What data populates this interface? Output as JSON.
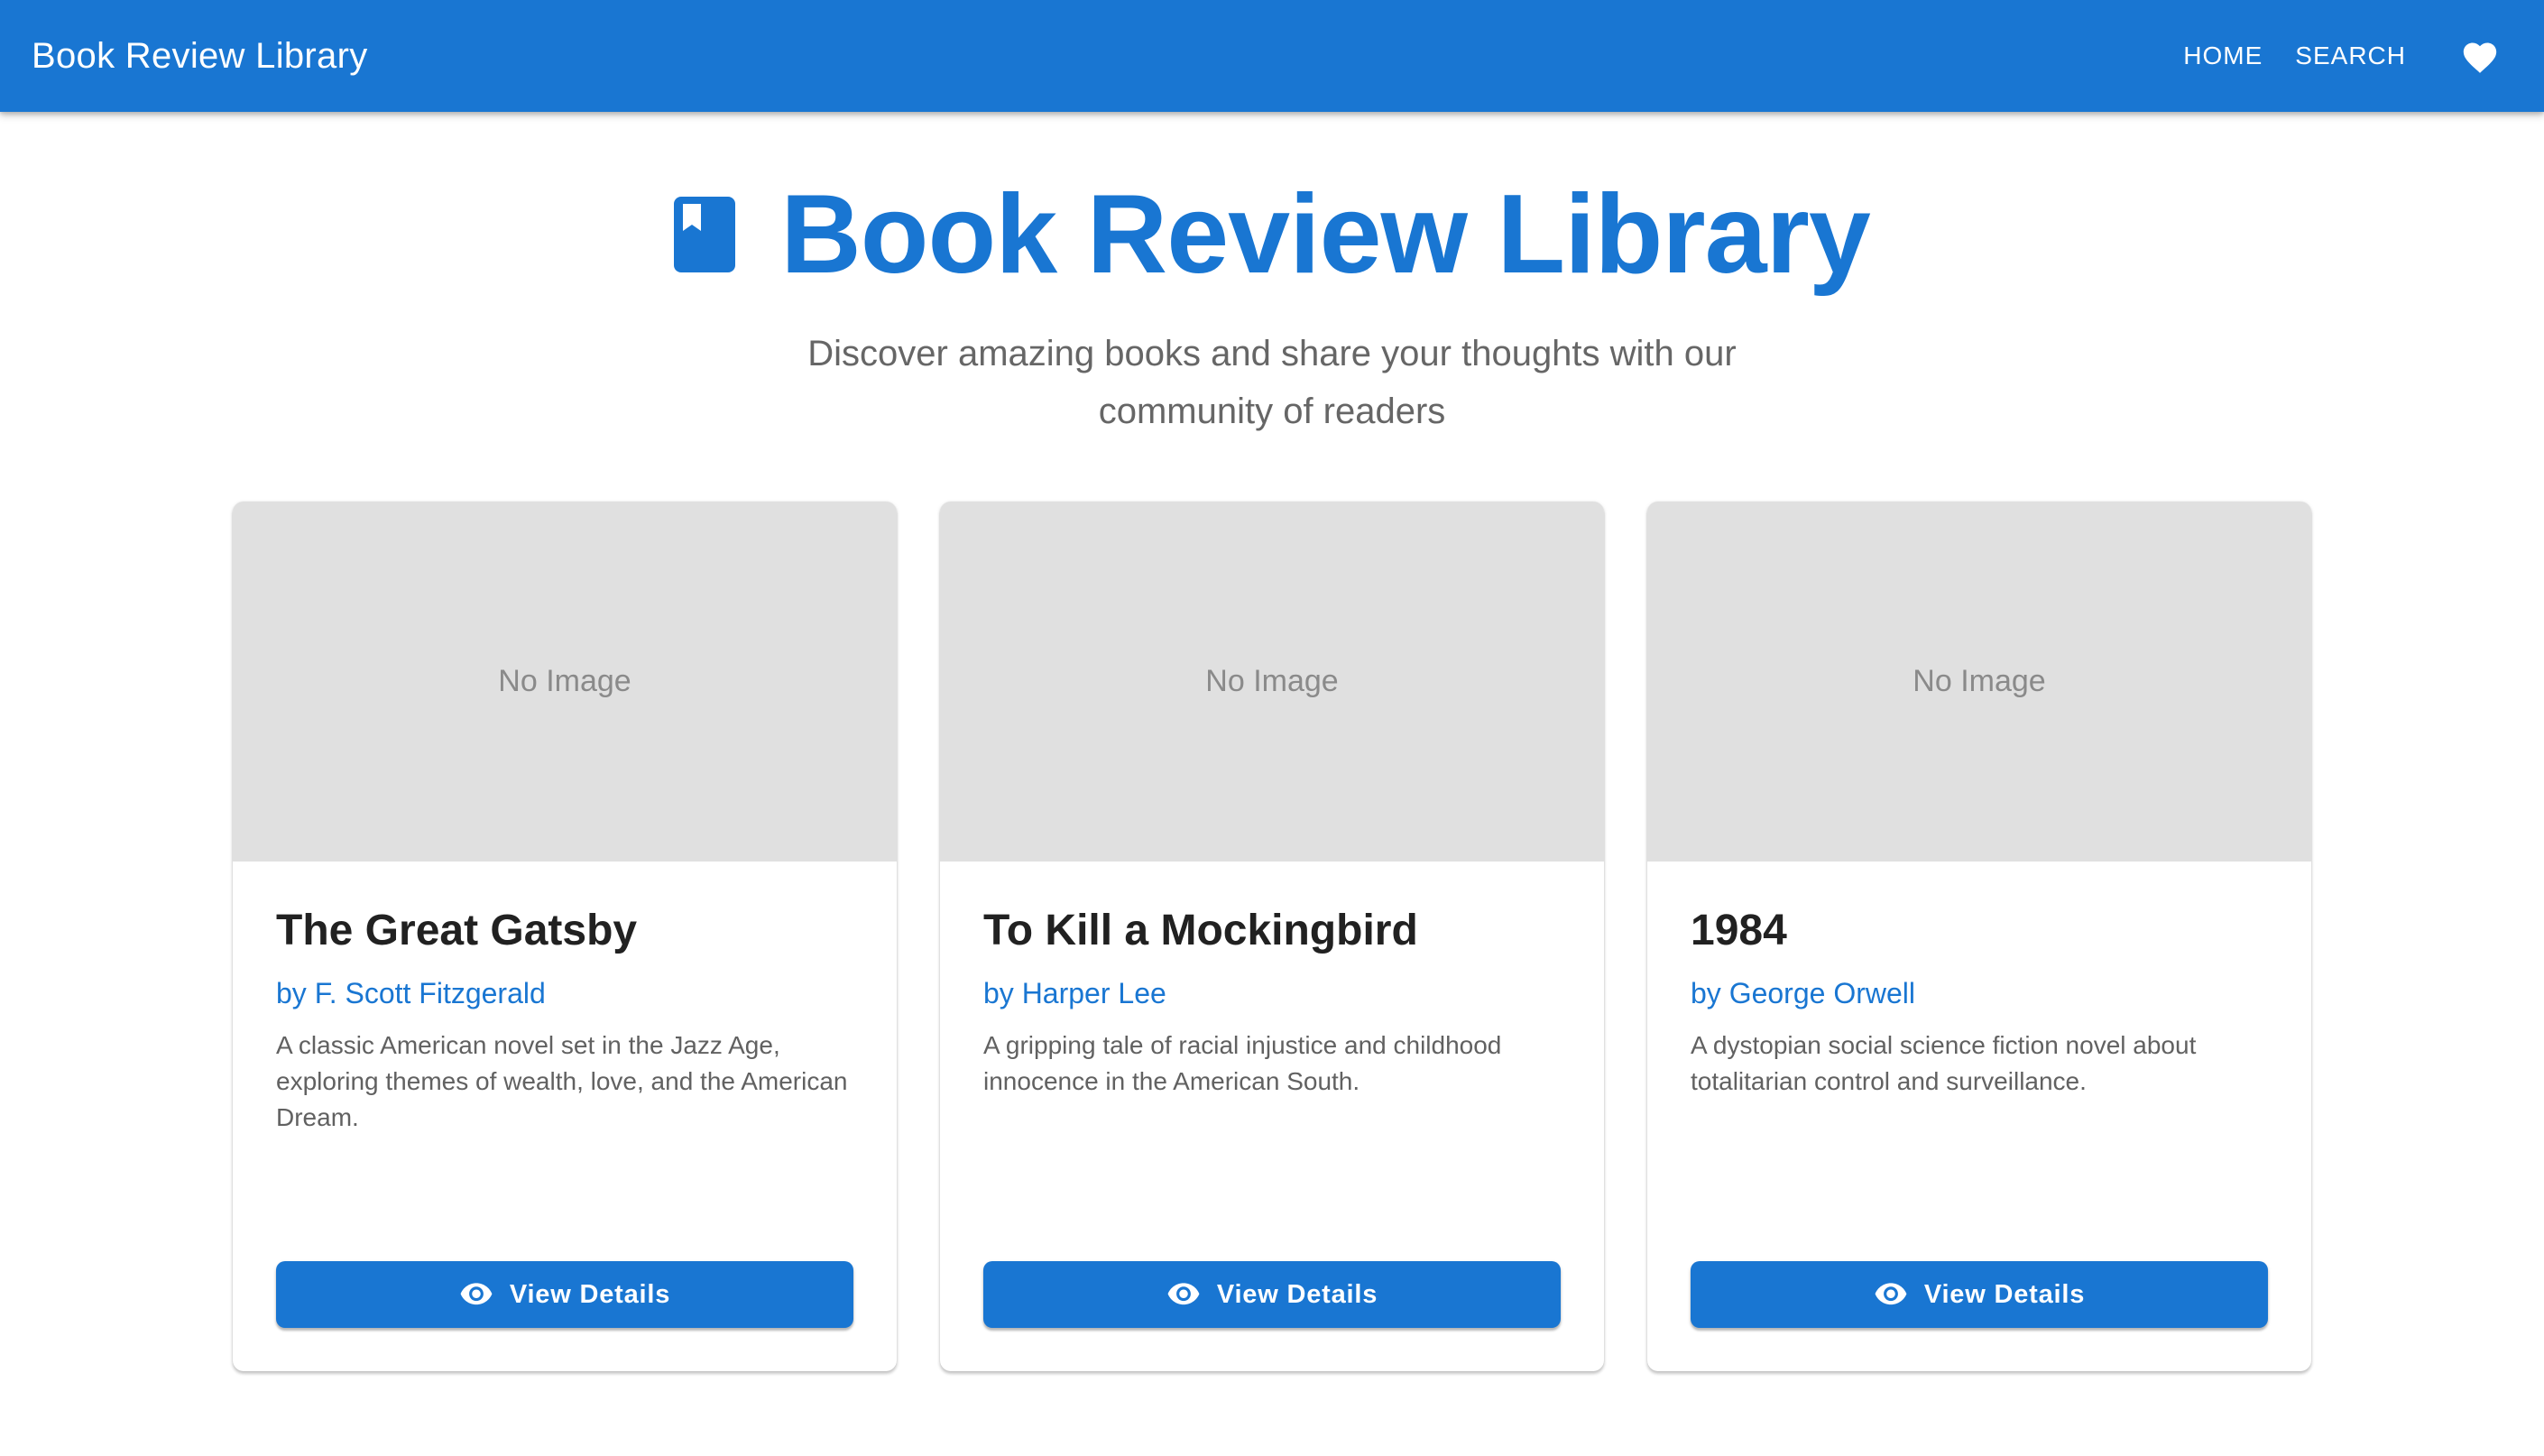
{
  "appbar": {
    "title": "Book Review Library",
    "nav": [
      {
        "label": "HOME"
      },
      {
        "label": "SEARCH"
      }
    ],
    "favorites_icon": "heart-icon"
  },
  "hero": {
    "icon": "book-icon",
    "title": "Book Review Library",
    "subtitle": "Discover amazing books and share your thoughts with our community of readers"
  },
  "books": [
    {
      "image_placeholder": "No Image",
      "title": "The Great Gatsby",
      "author": "by F. Scott Fitzgerald",
      "description": "A classic American novel set in the Jazz Age, exploring themes of wealth, love, and the American Dream.",
      "button_label": "View Details"
    },
    {
      "image_placeholder": "No Image",
      "title": "To Kill a Mockingbird",
      "author": "by Harper Lee",
      "description": "A gripping tale of racial injustice and childhood innocence in the American South.",
      "button_label": "View Details"
    },
    {
      "image_placeholder": "No Image",
      "title": "1984",
      "author": "by George Orwell",
      "description": "A dystopian social science fiction novel about totalitarian control and surveillance.",
      "button_label": "View Details"
    }
  ],
  "colors": {
    "primary": "#1976d2",
    "placeholder_bg": "#e0e0e0",
    "subtitle_text": "#666666"
  }
}
